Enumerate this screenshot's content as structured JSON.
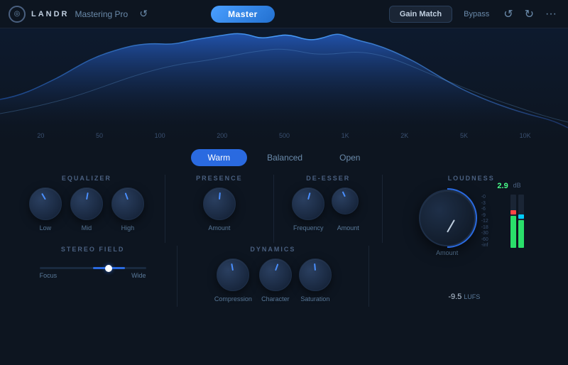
{
  "header": {
    "logo_text": "LANDR",
    "app_name": "Mastering Pro",
    "master_label": "Master",
    "gain_match_label": "Gain Match",
    "bypass_label": "Bypass"
  },
  "spectrum": {
    "freq_labels": [
      "20",
      "50",
      "100",
      "200",
      "500",
      "1K",
      "2K",
      "5K",
      "10K"
    ]
  },
  "style_tabs": {
    "tabs": [
      {
        "label": "Warm",
        "active": true
      },
      {
        "label": "Balanced",
        "active": false
      },
      {
        "label": "Open",
        "active": false
      }
    ]
  },
  "equalizer": {
    "section_label": "EQUALIZER",
    "knobs": [
      {
        "label": "Low"
      },
      {
        "label": "Mid"
      },
      {
        "label": "High"
      }
    ]
  },
  "presence": {
    "section_label": "PRESENCE",
    "knobs": [
      {
        "label": "Amount"
      }
    ]
  },
  "deesser": {
    "section_label": "DE-ESSER",
    "knobs": [
      {
        "label": "Frequency"
      },
      {
        "label": "Amount"
      }
    ]
  },
  "stereo_field": {
    "section_label": "STEREO FIELD",
    "focus_label": "Focus",
    "wide_label": "Wide"
  },
  "dynamics": {
    "section_label": "DYNAMICS",
    "knobs": [
      {
        "label": "Compression"
      },
      {
        "label": "Character"
      },
      {
        "label": "Saturation"
      }
    ]
  },
  "loudness": {
    "section_label": "LOUDNESS",
    "amount_label": "Amount",
    "db_value": "2.9",
    "db_unit": "dB",
    "lufs_value": "-9.5",
    "lufs_unit": "LUFS"
  },
  "meter": {
    "scale_labels": [
      "-0",
      "-3",
      "-6",
      "-9",
      "-12",
      "-18",
      "-30",
      "-60",
      "-inf"
    ]
  }
}
